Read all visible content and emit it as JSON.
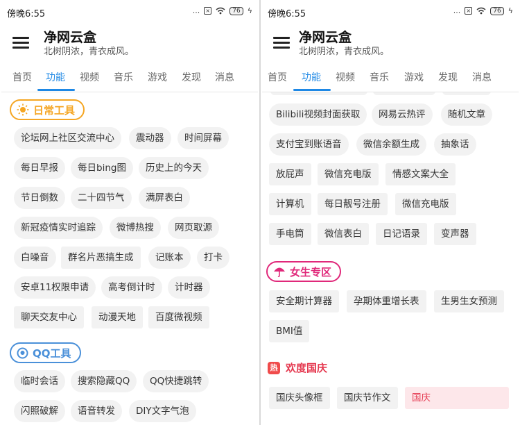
{
  "status": {
    "time": "傍晚6:55",
    "dots": "...",
    "battery": "76"
  },
  "app": {
    "title": "净网云盒",
    "subtitle": "北树阴浓，青衣成风。"
  },
  "tabs": [
    "首页",
    "功能",
    "视频",
    "音乐",
    "游戏",
    "发现",
    "消息"
  ],
  "active_tab": "功能",
  "left": {
    "daily_tools": {
      "title": "日常工具",
      "icon": "sun-icon",
      "color": "#f5a623",
      "items": [
        "论坛网上社区交流中心",
        "震动器",
        "时间屏幕",
        "每日早报",
        "每日bing图",
        "历史上的今天",
        "节日倒数",
        "二十四节气",
        "满屏表白",
        "新冠疫情实时追踪",
        "微博热搜",
        "网页取源",
        "白噪音",
        "群名片恶搞生成",
        "记账本",
        "打卡",
        "安卓11权限申请",
        "高考倒计时",
        "计时器",
        "聊天交友中心",
        "动漫天地",
        "百度微视频"
      ]
    },
    "qq_tools": {
      "title": "QQ工具",
      "icon": "qq-icon",
      "color": "#4a90d9",
      "items": [
        "临时会话",
        "搜索隐藏QQ",
        "QQ快捷跳转",
        "闪照破解",
        "语音转发",
        "DIY文字气泡"
      ]
    }
  },
  "right": {
    "more_tools": [
      "Bilibili视频封面获取",
      "网易云热评",
      "随机文章",
      "支付宝到账语音",
      "微信余额生成",
      "抽象话",
      "放屁声",
      "微信充电版",
      "情感文案大全",
      "计算机",
      "每日靓号注册",
      "微信充电版",
      "手电筒",
      "微信表白",
      "日记语录",
      "变声器"
    ],
    "female_zone": {
      "title": "女生专区",
      "icon": "umbrella-icon",
      "color": "#e0287a",
      "items": [
        "安全期计算器",
        "孕期体重增长表",
        "生男生女预测",
        "BMI值"
      ]
    },
    "national_day": {
      "title": "欢度国庆",
      "badge": "热",
      "color": "#e53950",
      "items": [
        "国庆头像框",
        "国庆节作文",
        "国庆"
      ]
    }
  }
}
